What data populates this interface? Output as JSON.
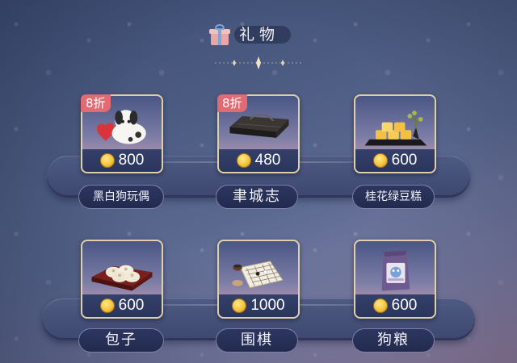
{
  "header": {
    "title": "礼物"
  },
  "colors": {
    "coin": "#f4c53e",
    "discount": "#e26a73",
    "card_border": "#e0cfa8"
  },
  "gifts": [
    {
      "name": "黑白狗玩偶",
      "price": "800",
      "discount": "8折",
      "icon": "dog-plush-icon"
    },
    {
      "name": "聿城志",
      "price": "480",
      "discount": "8折",
      "icon": "book-icon"
    },
    {
      "name": "桂花绿豆糕",
      "price": "600",
      "discount": "",
      "icon": "mung-bean-cake-icon"
    },
    {
      "name": "包子",
      "price": "600",
      "discount": "",
      "icon": "steamed-bun-icon"
    },
    {
      "name": "围棋",
      "price": "1000",
      "discount": "",
      "icon": "go-board-icon"
    },
    {
      "name": "狗粮",
      "price": "600",
      "discount": "",
      "icon": "dog-food-bag-icon"
    }
  ]
}
